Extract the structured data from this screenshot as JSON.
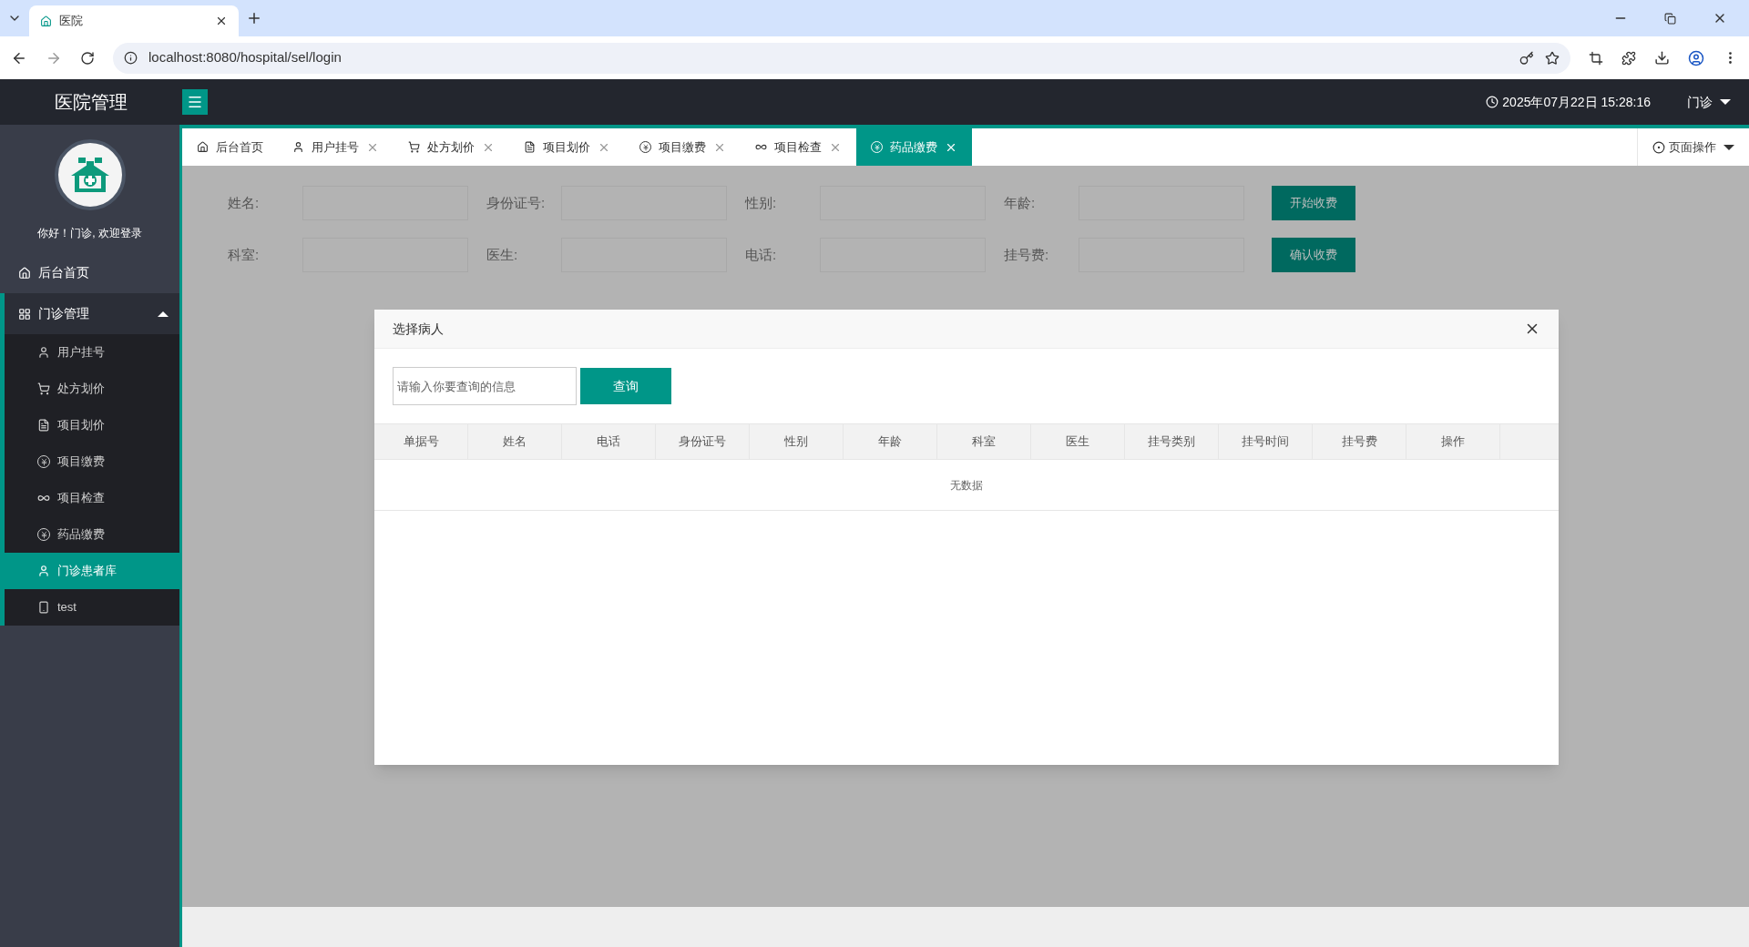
{
  "browser": {
    "tab_title": "医院",
    "url": "localhost:8080/hospital/sel/login"
  },
  "header": {
    "title": "医院管理",
    "datetime": "2025年07月22日 15:28:16",
    "user": "门诊"
  },
  "sidebar": {
    "greeting": "你好！门诊, 欢迎登录",
    "items": [
      {
        "label": "后台首页",
        "selected": false
      },
      {
        "label": "门诊管理",
        "selected": false,
        "expanded": true,
        "children": [
          {
            "label": "用户挂号",
            "selected": false
          },
          {
            "label": "处方划价",
            "selected": false
          },
          {
            "label": "项目划价",
            "selected": false
          },
          {
            "label": "项目缴费",
            "selected": false
          },
          {
            "label": "项目检查",
            "selected": false
          },
          {
            "label": "药品缴费",
            "selected": false
          },
          {
            "label": "门诊患者库",
            "selected": true
          },
          {
            "label": "test",
            "selected": false
          }
        ]
      }
    ]
  },
  "tabs": [
    {
      "label": "后台首页",
      "closable": false,
      "selected": false
    },
    {
      "label": "用户挂号",
      "closable": true,
      "selected": false
    },
    {
      "label": "处方划价",
      "closable": true,
      "selected": false
    },
    {
      "label": "项目划价",
      "closable": true,
      "selected": false
    },
    {
      "label": "项目缴费",
      "closable": true,
      "selected": false
    },
    {
      "label": "项目检查",
      "closable": true,
      "selected": false
    },
    {
      "label": "药品缴费",
      "closable": true,
      "selected": true
    }
  ],
  "page_ops": "页面操作",
  "form": {
    "rows": [
      {
        "fields": [
          "姓名:",
          "身份证号:",
          "性别:",
          "年龄:"
        ],
        "button": "开始收费"
      },
      {
        "fields": [
          "科室:",
          "医生:",
          "电话:",
          "挂号费:"
        ],
        "button": "确认收费"
      }
    ]
  },
  "modal": {
    "title": "选择病人",
    "search_placeholder": "请输入你要查询的信息",
    "search_button": "查询",
    "columns": [
      "单据号",
      "姓名",
      "电话",
      "身份证号",
      "性别",
      "年龄",
      "科室",
      "医生",
      "挂号类别",
      "挂号时间",
      "挂号费",
      "操作"
    ],
    "empty_text": "无数据"
  }
}
